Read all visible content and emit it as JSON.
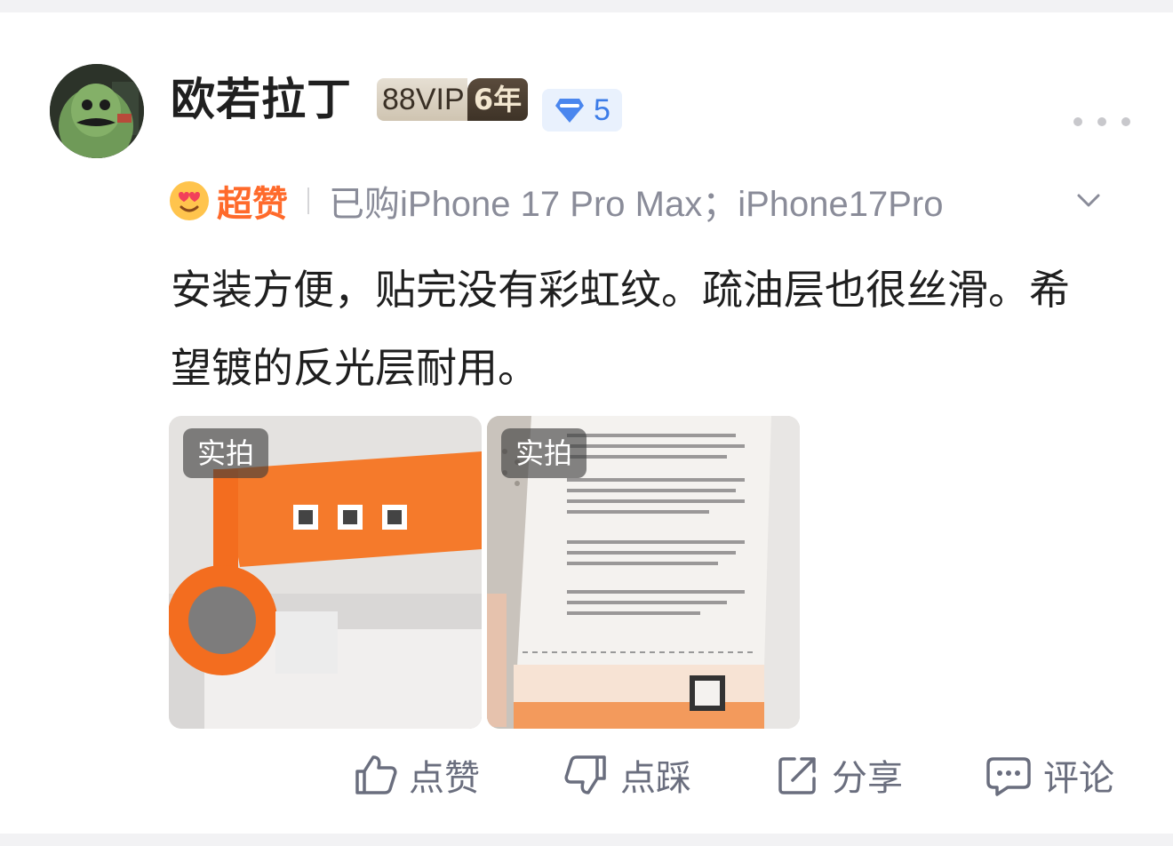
{
  "user": {
    "name": "欧若拉丁",
    "vip_label": "88VIP",
    "vip_years": "6年",
    "level": "5"
  },
  "rating": {
    "label": "超赞",
    "purchased": "已购iPhone 17 Pro Max；iPhone17Pro"
  },
  "review_text": "安装方便，贴完没有彩虹纹。疏油层也很丝滑。希望镀的反光层耐用。",
  "photos": [
    {
      "tag": "实拍"
    },
    {
      "tag": "实拍"
    }
  ],
  "actions": {
    "like": "点赞",
    "dislike": "点踩",
    "share": "分享",
    "comment": "评论"
  },
  "colors": {
    "accent_orange": "#ff6a2b",
    "level_blue": "#3c7ce8",
    "muted_text": "#8a8c99"
  },
  "icons": [
    "avatar",
    "diamond-icon",
    "more-icon",
    "heart-eyes-emoji-icon",
    "chevron-down-icon",
    "thumbs-up-icon",
    "thumbs-down-icon",
    "share-icon",
    "comment-icon"
  ]
}
